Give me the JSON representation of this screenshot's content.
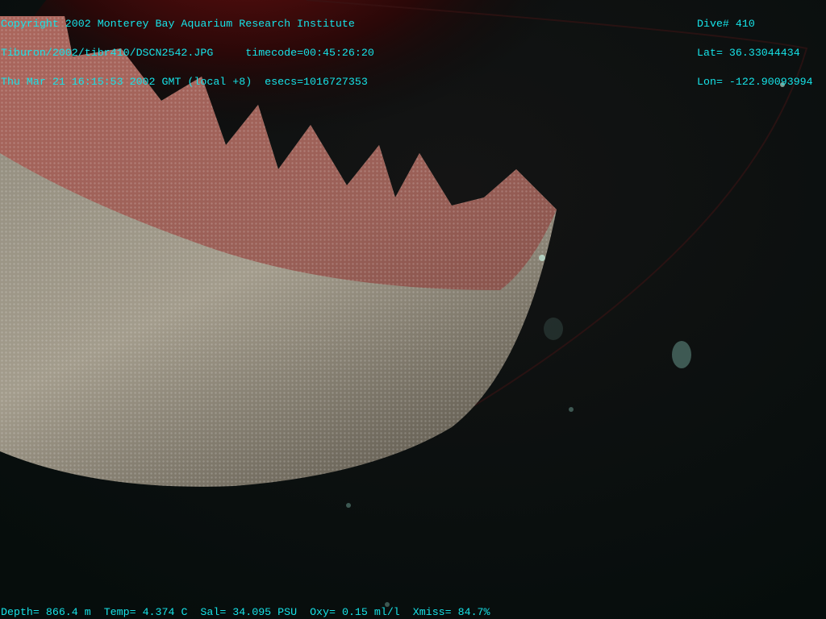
{
  "overlay": {
    "top_left": {
      "copyright": "Copyright 2002 Monterey Bay Aquarium Research Institute",
      "file": "Tiburon/2002/tibr410/DSCN2542.JPG",
      "timecode": "timecode=00:45:26:20",
      "datetime": "Thu Mar 21 16:15:53 2002 GMT (local +8)",
      "esecs": "esecs=1016727353"
    },
    "top_right": {
      "dive": "Dive# 410",
      "lat": "Lat= 36.33044434",
      "lon": "Lon= -122.90093994"
    },
    "bottom": {
      "depth": "Depth= 866.4 m",
      "temp": "Temp= 4.374 C",
      "sal": "Sal= 34.095 PSU",
      "oxy": "Oxy= 0.15 ml/l",
      "xmiss": "Xmiss= 84.7%"
    }
  },
  "colors": {
    "overlay_text": "#16e3e8",
    "background": "#07100e"
  }
}
